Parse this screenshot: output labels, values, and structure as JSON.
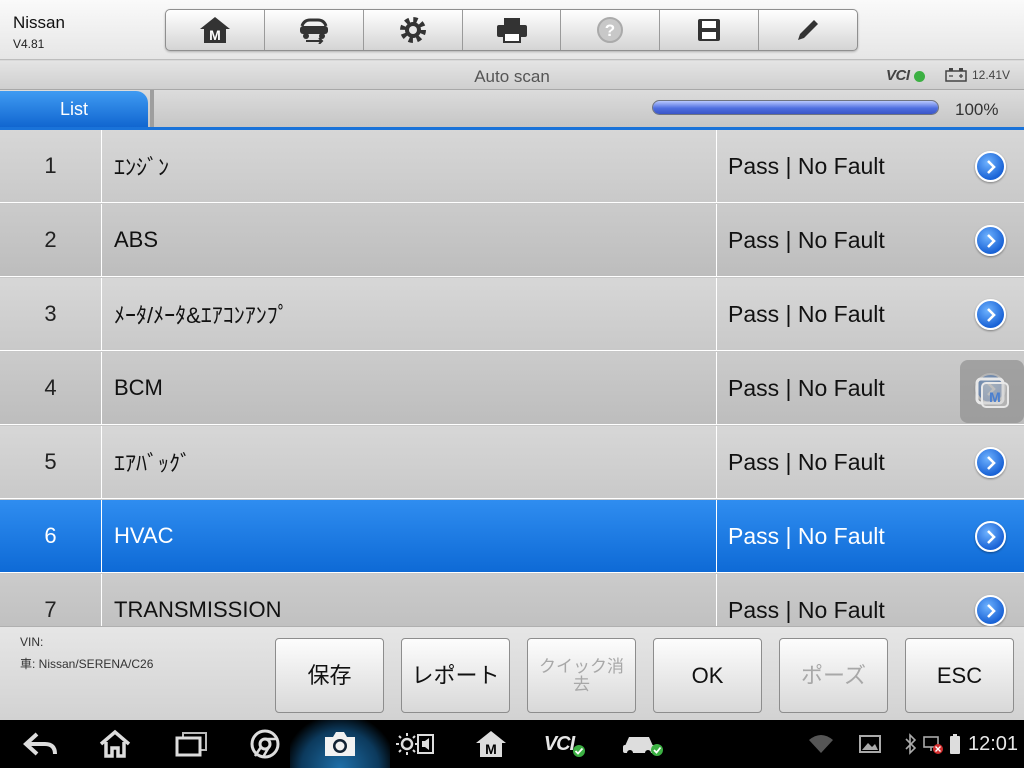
{
  "header": {
    "app_name": "Nissan",
    "version": "V4.81",
    "toolbar": [
      {
        "name": "home-m-icon"
      },
      {
        "name": "vehicle-swap-icon"
      },
      {
        "name": "gear-icon"
      },
      {
        "name": "printer-icon"
      },
      {
        "name": "help-icon"
      },
      {
        "name": "save-disk-icon"
      },
      {
        "name": "pencil-icon"
      }
    ]
  },
  "title_strip": {
    "title": "Auto scan",
    "vci": "VCI",
    "voltage": "12.41V"
  },
  "tabs": {
    "active": "List",
    "progress_value": 100,
    "progress_text": "100%"
  },
  "rows": [
    {
      "num": "1",
      "name": "ｴﾝｼﾞﾝ",
      "status": "Pass | No Fault"
    },
    {
      "num": "2",
      "name": "ABS",
      "status": "Pass | No Fault"
    },
    {
      "num": "3",
      "name": "ﾒｰﾀ/ﾒｰﾀ&ｴｱｺﾝｱﾝﾌﾟ",
      "status": "Pass | No Fault"
    },
    {
      "num": "4",
      "name": "BCM",
      "status": "Pass | No Fault"
    },
    {
      "num": "5",
      "name": "ｴｱﾊﾞｯｸﾞ",
      "status": "Pass | No Fault"
    },
    {
      "num": "6",
      "name": "HVAC",
      "status": "Pass | No Fault",
      "selected": true
    },
    {
      "num": "7",
      "name": "TRANSMISSION",
      "status": "Pass | No Fault"
    }
  ],
  "footer": {
    "vin_label": "VIN:",
    "vehicle": "車: Nissan/SERENA/C26",
    "buttons": {
      "save": "保存",
      "report": "レポート",
      "quick_clear": "クイック消去",
      "ok": "OK",
      "pause": "ポーズ",
      "esc": "ESC"
    }
  },
  "navbar": {
    "vci": "VCI",
    "clock": "12:01"
  },
  "colors": {
    "accent": "#1a73d9",
    "selected_row": "#1a73e0",
    "status_ok": "#3cb043"
  }
}
